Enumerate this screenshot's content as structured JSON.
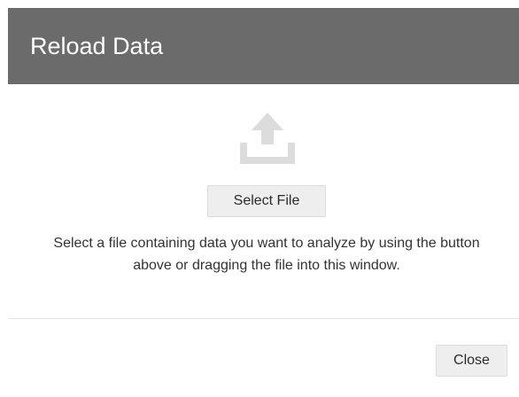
{
  "dialog": {
    "title": "Reload Data",
    "upload_icon": "upload-icon",
    "select_file_label": "Select File",
    "instructions": "Select a file containing data you want to analyze by using the button above or dragging the file into this window.",
    "close_label": "Close"
  },
  "colors": {
    "header_bg": "#6b6b6b",
    "header_text": "#ffffff",
    "icon": "#dcdcdc",
    "button_bg": "#eeeeee"
  }
}
